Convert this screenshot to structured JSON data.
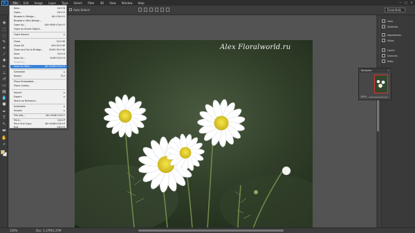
{
  "menubar": {
    "logo": "Ps",
    "items": [
      "File",
      "Edit",
      "Image",
      "Layer",
      "Type",
      "Select",
      "Filter",
      "3D",
      "View",
      "Window",
      "Help"
    ],
    "window_controls": [
      "—",
      "□",
      "✕"
    ]
  },
  "options": {
    "auto_select_label": "Auto-Select:",
    "workspace": "Essentials"
  },
  "file_menu": {
    "items": [
      {
        "label": "New...",
        "shortcut": "Ctrl+N"
      },
      {
        "label": "Open...",
        "shortcut": "Ctrl+O"
      },
      {
        "label": "Browse in Bridge...",
        "shortcut": "Alt+Ctrl+O"
      },
      {
        "label": "Browse in Mini Bridge...",
        "shortcut": ""
      },
      {
        "label": "Open As...",
        "shortcut": "Alt+Shift+Ctrl+O"
      },
      {
        "label": "Open as Smart Object...",
        "shortcut": ""
      },
      {
        "label": "Open Recent",
        "shortcut": "▸"
      },
      {
        "label": "Close",
        "shortcut": "Ctrl+W"
      },
      {
        "label": "Close All",
        "shortcut": "Alt+Ctrl+W"
      },
      {
        "label": "Close and Go to Bridge...",
        "shortcut": "Shift+Ctrl+W"
      },
      {
        "label": "Save",
        "shortcut": "Ctrl+S"
      },
      {
        "label": "Save As...",
        "shortcut": "Shift+Ctrl+S"
      },
      {
        "label": "Check In...",
        "shortcut": ""
      },
      {
        "label": "Save for Web...",
        "shortcut": "Alt+Shift+Ctrl+S"
      },
      {
        "label": "Generate",
        "shortcut": "▸"
      },
      {
        "label": "Revert",
        "shortcut": "F12"
      },
      {
        "label": "Place Embedded...",
        "shortcut": ""
      },
      {
        "label": "Place Linked...",
        "shortcut": ""
      },
      {
        "label": "Import",
        "shortcut": "▸"
      },
      {
        "label": "Export",
        "shortcut": "▸"
      },
      {
        "label": "Share on Behance...",
        "shortcut": ""
      },
      {
        "label": "Automate",
        "shortcut": "▸"
      },
      {
        "label": "Scripts",
        "shortcut": "▸"
      },
      {
        "label": "File Info...",
        "shortcut": "Alt+Shift+Ctrl+I"
      },
      {
        "label": "Print...",
        "shortcut": "Ctrl+P"
      },
      {
        "label": "Print One Copy",
        "shortcut": "Alt+Shift+Ctrl+P"
      },
      {
        "label": "Exit",
        "shortcut": "Ctrl+Q"
      }
    ]
  },
  "canvas": {
    "watermark": "Alex Floralworld.ru"
  },
  "navigator": {
    "title": "Navigator",
    "zoom": "100%"
  },
  "panels": {
    "items": [
      "Color",
      "Swatches",
      "Adjustments",
      "Styles",
      "Layers",
      "Channels",
      "Paths"
    ]
  },
  "status": {
    "zoom": "100%",
    "doc": "Doc: 1,37M/1,37M"
  },
  "colors": {
    "highlight": "#3b82d6",
    "foreground": "#e9d64f",
    "background": "#ffffff"
  }
}
